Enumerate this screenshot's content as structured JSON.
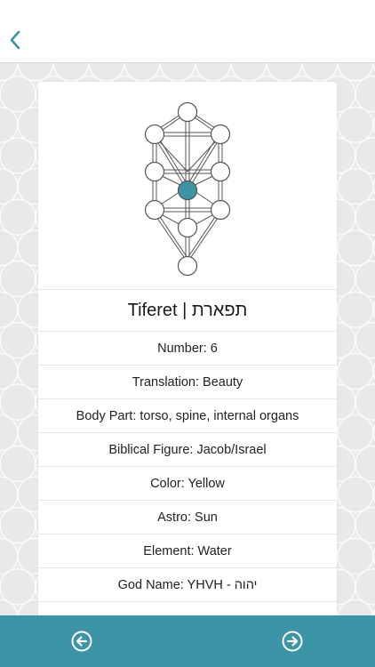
{
  "colors": {
    "accent": "#3d94a6",
    "sefira_fill": "#3d94a6",
    "line": "#555555"
  },
  "header": {
    "back_icon": "chevron-left-icon"
  },
  "sefira": {
    "title": "Tiferet | תפארת",
    "highlighted": "Tiferet"
  },
  "details": [
    "Number: 6",
    "Translation: Beauty",
    "Body Part: torso, spine, internal organs",
    "Biblical Figure: Jacob/Israel",
    "Color: Yellow",
    "Astro: Sun",
    "Element: Water",
    "God Name: YHVH - יהוה"
  ],
  "footer": {
    "prev_icon": "arrow-left-circle-icon",
    "next_icon": "arrow-right-circle-icon"
  }
}
